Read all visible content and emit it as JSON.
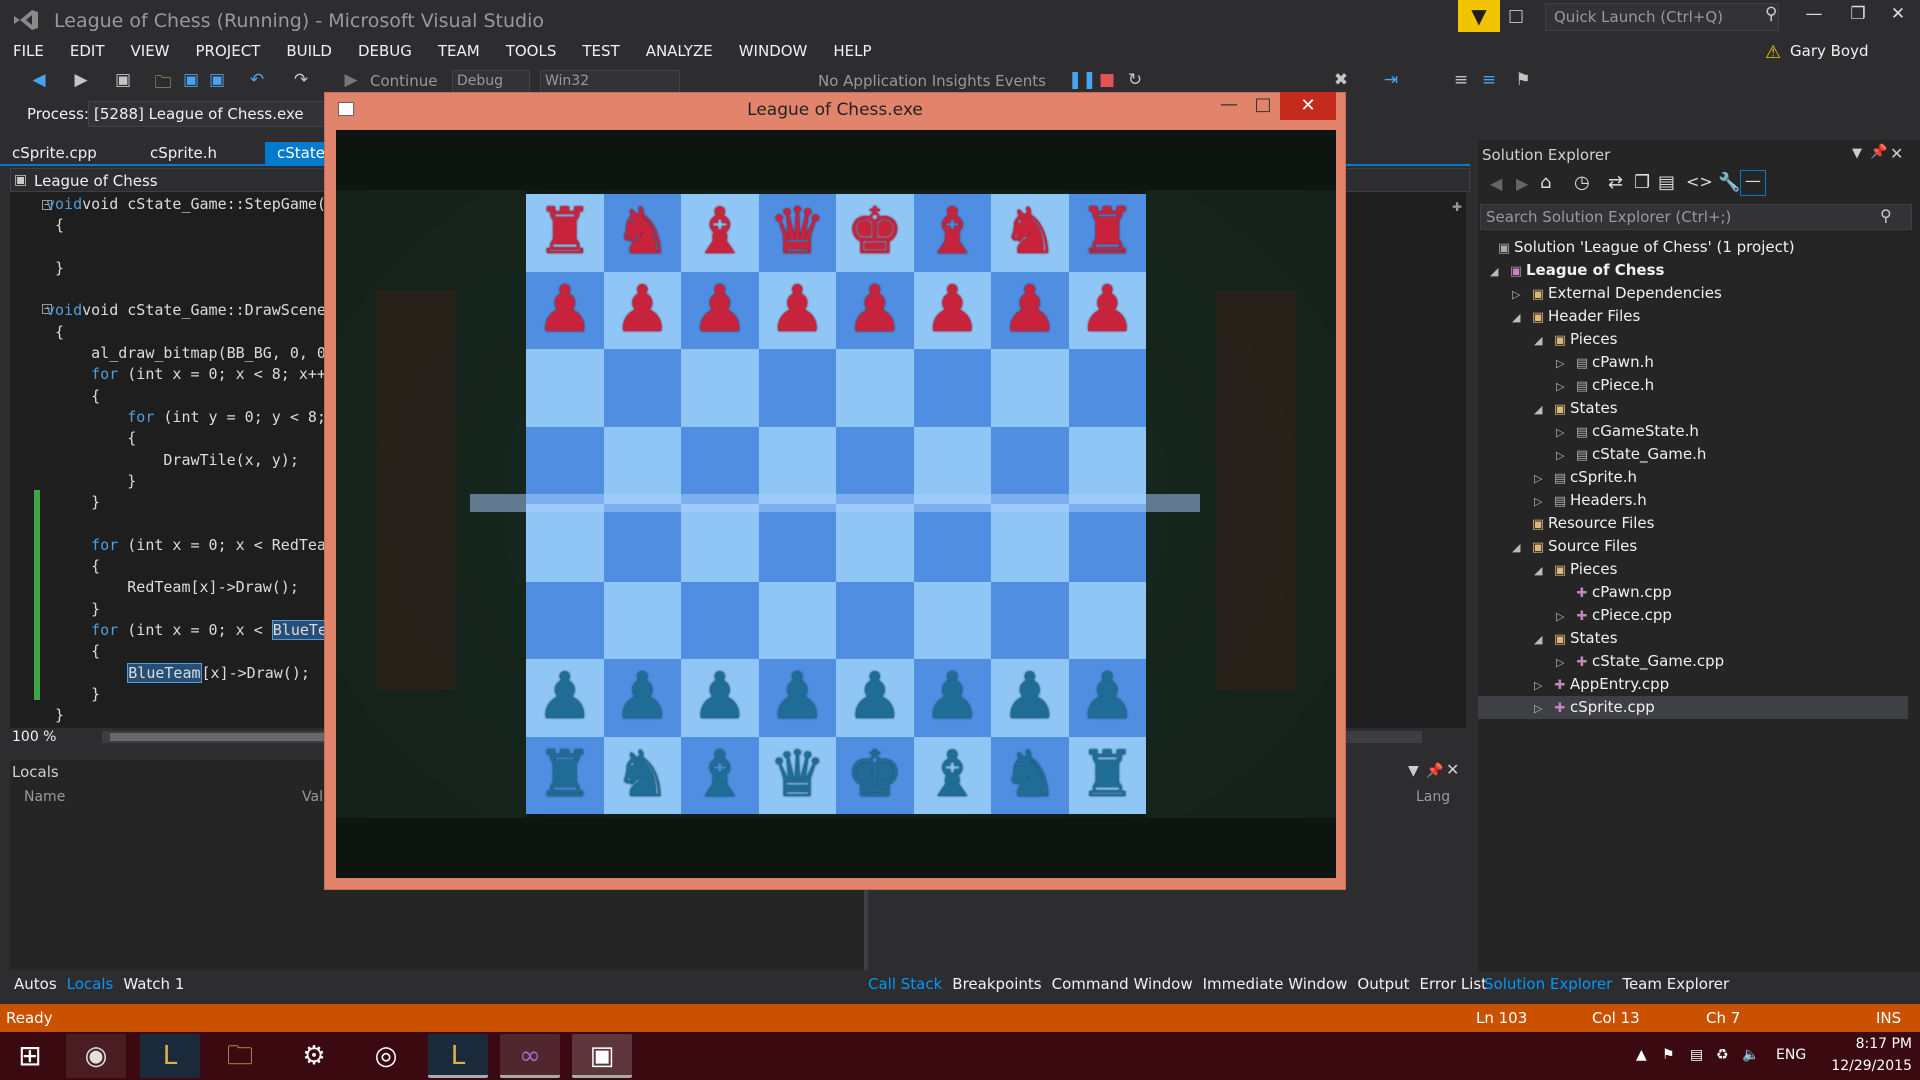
{
  "window": {
    "title": "League of Chess (Running) - Microsoft Visual Studio"
  },
  "quick_launch": {
    "placeholder": "Quick Launch (Ctrl+Q)"
  },
  "user": {
    "name": "Gary Boyd"
  },
  "menu": [
    "FILE",
    "EDIT",
    "VIEW",
    "PROJECT",
    "BUILD",
    "DEBUG",
    "TEAM",
    "TOOLS",
    "TEST",
    "ANALYZE",
    "WINDOW",
    "HELP"
  ],
  "toolbar": {
    "continue": "Continue",
    "config": "Debug",
    "platform": "Win32",
    "insights": "No Application Insights Events"
  },
  "process": {
    "label": "Process:",
    "value": "[5288] League of Chess.exe"
  },
  "tabs": [
    "cSprite.cpp",
    "cSprite.h",
    "cState_G"
  ],
  "navbar": {
    "project": "League of Chess"
  },
  "code": {
    "l1": "void cState_Game::StepGame()",
    "l2": "{",
    "l3": "}",
    "l4": "void cState_Game::DrawScene()",
    "l5": "{",
    "l6": "al_draw_bitmap(BB_BG, 0, 0",
    "l7a": "for",
    "l7b": " (int x = 0; x < 8; x++",
    "l8": "{",
    "l9a": "for",
    "l9b": " (int y = 0; y < 8;",
    "l10": "{",
    "l11": "DrawTile(x, y);",
    "l12": "}",
    "l13": "}",
    "l14a": "for",
    "l14b": " (int x = 0; x < RedTea",
    "l15": "{",
    "l16": "RedTeam[x]->Draw();",
    "l17": "}",
    "l18a": "for",
    "l18b": " (int x = 0; x < ",
    "l18c": "BlueTe",
    "l19": "{",
    "l20a": "BlueTeam",
    "l20b": "[x]->Draw();",
    "l21": "}",
    "l22": "}"
  },
  "zoom": "100 %",
  "locals": {
    "title": "Locals",
    "col_name": "Name",
    "col_value": "Val",
    "col_lang": "Lang"
  },
  "bottom_left_tabs": [
    "Autos",
    "Locals",
    "Watch 1"
  ],
  "bottom_mid_tabs": [
    "Call Stack",
    "Breakpoints",
    "Command Window",
    "Immediate Window",
    "Output",
    "Error List"
  ],
  "bottom_right_tabs": [
    "Solution Explorer",
    "Team Explorer"
  ],
  "solution_explorer": {
    "title": "Solution Explorer",
    "search_placeholder": "Search Solution Explorer (Ctrl+;)",
    "items": [
      {
        "label": "Solution 'League of Chess' (1 project)"
      },
      {
        "label": "League of Chess"
      },
      {
        "label": "External Dependencies"
      },
      {
        "label": "Header Files"
      },
      {
        "label": "Pieces"
      },
      {
        "label": "cPawn.h"
      },
      {
        "label": "cPiece.h"
      },
      {
        "label": "States"
      },
      {
        "label": "cGameState.h"
      },
      {
        "label": "cState_Game.h"
      },
      {
        "label": "cSprite.h"
      },
      {
        "label": "Headers.h"
      },
      {
        "label": "Resource Files"
      },
      {
        "label": "Source Files"
      },
      {
        "label": "Pieces"
      },
      {
        "label": "cPawn.cpp"
      },
      {
        "label": "cPiece.cpp"
      },
      {
        "label": "States"
      },
      {
        "label": "cState_Game.cpp"
      },
      {
        "label": "AppEntry.cpp"
      },
      {
        "label": "cSprite.cpp"
      }
    ]
  },
  "status": {
    "ready": "Ready",
    "ln": "Ln 103",
    "col": "Col 13",
    "ch": "Ch 7",
    "ins": "INS"
  },
  "tray": {
    "lang": "ENG",
    "time": "8:17 PM",
    "date": "12/29/2015"
  },
  "game": {
    "title": "League of Chess.exe"
  },
  "colors": {
    "accent": "#007acc",
    "status": "#ca5100",
    "board_light": "#8fc6f5",
    "board_dark": "#4f8ee0",
    "red_team": "#c8233c",
    "blue_team": "#1f6d96"
  }
}
